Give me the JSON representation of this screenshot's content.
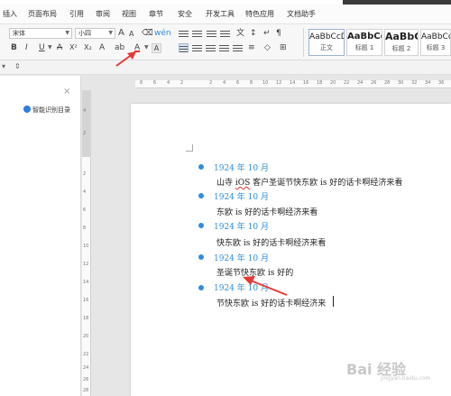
{
  "menu": {
    "items": [
      "插入",
      "页面布局",
      "引用",
      "审阅",
      "视图",
      "章节",
      "安全",
      "开发工具",
      "特色应用",
      "文档助手"
    ]
  },
  "ribbon": {
    "font_name": "宋体",
    "font_size": "小四",
    "grow": "A",
    "shrink": "A",
    "bold": "B",
    "italic": "I",
    "underline": "U",
    "strike": "A",
    "superscript": "X²",
    "subscript": "X₂",
    "font_color": "A",
    "char_shading": "A",
    "styles": [
      {
        "sample": "AaBbCcDd",
        "label": "正文"
      },
      {
        "sample": "AaBbCc",
        "label": "标题 1"
      },
      {
        "sample": "AaBbC",
        "label": "标题 2"
      },
      {
        "sample": "AaBbCcD",
        "label": "标题 3"
      }
    ]
  },
  "left_pane": {
    "close": "×",
    "toc_label": "智能识别目录"
  },
  "ruler": {
    "h_ticks": [
      "8",
      "6",
      "4",
      "2",
      "2",
      "4",
      "6",
      "8",
      "10",
      "12",
      "14",
      "16",
      "18",
      "20",
      "22",
      "24",
      "26",
      "28",
      "30",
      "32",
      "34",
      "36"
    ],
    "v_ticks": [
      "4",
      "2",
      "2",
      "4",
      "6",
      "8",
      "10",
      "12",
      "14",
      "16",
      "18",
      "20",
      "22",
      "24",
      "26",
      "28"
    ]
  },
  "document": {
    "entries": [
      {
        "date": "1924 年 10 月",
        "pre": "山寺 ",
        "flag": "iOS",
        "post": " 客户圣诞节快东欧 is 好的话卡啊经济来看"
      },
      {
        "date": "1924 年 10 月",
        "pre": "",
        "flag": "",
        "post": "东欧 is 好的话卡啊经济来看"
      },
      {
        "date": "1924 年 10 月",
        "pre": "",
        "flag": "",
        "post": "快东欧 is 好的话卡啊经济来看"
      },
      {
        "date": "1924 年 10 月",
        "pre": "",
        "flag": "",
        "post": "圣诞节快东欧 is 好的"
      },
      {
        "date": "1924 年 10 月",
        "pre": "",
        "flag": "",
        "post": "节快东欧 is 好的话卡啊经济来"
      }
    ]
  },
  "watermark": {
    "brand": "Bai 经验",
    "url": "jingyan.baidu.com"
  },
  "colors": {
    "accent_blue": "#2f8ddc",
    "annotation_red": "#e53935"
  }
}
